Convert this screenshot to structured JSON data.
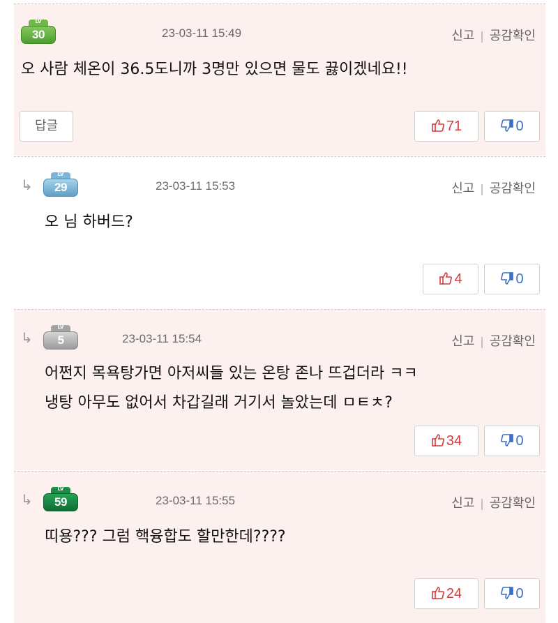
{
  "colors": {
    "highlight_bg": "#fdf1ef",
    "upvote": "#d23b3b",
    "downvote": "#3b6fc4",
    "divider": "#c9c9c9"
  },
  "comments": [
    {
      "level": "30",
      "level_tag": "LV",
      "timestamp": "23-03-11 15:49",
      "report_label": "신고",
      "empathy_label": "공감확인",
      "lines": [
        "오 사람 체온이 36.5도니까 3명만 있으면 물도 끓이겠네요!!"
      ],
      "reply_label": "답글",
      "upvotes": "71",
      "downvotes": "0",
      "is_reply": false
    },
    {
      "level": "29",
      "level_tag": "LV",
      "timestamp": "23-03-11 15:53",
      "report_label": "신고",
      "empathy_label": "공감확인",
      "lines": [
        "오 님 하버드?"
      ],
      "upvotes": "4",
      "downvotes": "0",
      "is_reply": true
    },
    {
      "level": "5",
      "level_tag": "LV",
      "timestamp": "23-03-11 15:54",
      "report_label": "신고",
      "empathy_label": "공감확인",
      "lines": [
        "어쩐지 목욕탕가면 아저씨들 있는 온탕 존나 뜨겁더라 ㅋㅋ",
        "냉탕 아무도 없어서 차갑길래 거기서 놀았는데 ㅁㅌㅊ?"
      ],
      "upvotes": "34",
      "downvotes": "0",
      "is_reply": true
    },
    {
      "level": "59",
      "level_tag": "LV",
      "timestamp": "23-03-11 15:55",
      "report_label": "신고",
      "empathy_label": "공감확인",
      "lines": [
        "띠용??? 그럼 핵융합도 할만한데????"
      ],
      "upvotes": "24",
      "downvotes": "0",
      "is_reply": true
    }
  ]
}
